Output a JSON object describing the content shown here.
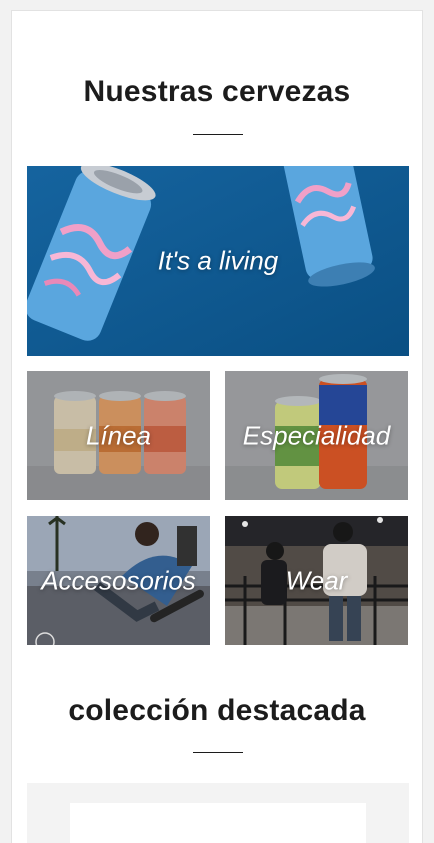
{
  "beers_section": {
    "title": "Nuestras cervezas"
  },
  "collections": [
    {
      "label": "It's a living",
      "image": "blue cans floating on blue background"
    },
    {
      "label": "Línea",
      "image": "three cans on grey background"
    },
    {
      "label": "Especialidad",
      "image": "two cans including DUÑA IPA on grey background"
    },
    {
      "label": "Accesosorios",
      "image": "skateboarder in a skatepark"
    },
    {
      "label": "Wear",
      "image": "skaters at night by a railing"
    }
  ],
  "featured_section": {
    "title": "colección destacada"
  },
  "colors": {
    "banner_blue": "#0d5a94",
    "text_dark": "#1c1c1c",
    "tile_grey": "#a8aaad"
  }
}
